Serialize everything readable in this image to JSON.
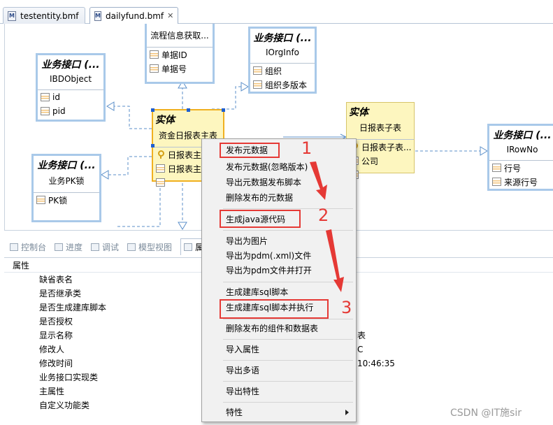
{
  "tabs": [
    {
      "label": "testentity.bmf",
      "icon": "bmf-file-icon"
    },
    {
      "label": "dailyfund.bmf",
      "icon": "bmf-file-icon",
      "close": "✕"
    }
  ],
  "diagram": {
    "nodes": [
      {
        "id": "n1",
        "title": "",
        "sub": "流程信息获取...",
        "attrs": [
          "单据ID",
          "单据号"
        ]
      },
      {
        "id": "n2",
        "title": "业务接口 (...",
        "sub": "IOrgInfo",
        "attrs": [
          "组织",
          "组织多版本"
        ]
      },
      {
        "id": "n3",
        "title": "业务接口 (...",
        "sub": "IBDObject",
        "attrs": [
          "id",
          "pid"
        ]
      },
      {
        "id": "n4",
        "title": "实体",
        "sub": "资金日报表主表",
        "attrs": [
          "日报表主",
          "日报表主",
          ""
        ]
      },
      {
        "id": "n5",
        "title": "实体",
        "sub": "日报表子表",
        "attrs": [
          "日报表子表...",
          "公司",
          ""
        ]
      },
      {
        "id": "n6",
        "title": "业务接口 (...",
        "sub": "IRowNo",
        "attrs": [
          "行号",
          "来源行号"
        ]
      },
      {
        "id": "n7",
        "title": "业务接口 (...",
        "sub": "业务PK锁",
        "attrs": [
          "PK锁"
        ]
      }
    ]
  },
  "panel": {
    "tabs": [
      "控制台",
      "进度",
      "调试",
      "模型视图",
      "属"
    ],
    "header": "属性",
    "rows": [
      {
        "name": "缺省表名",
        "value": ""
      },
      {
        "name": "是否继承类",
        "value": ""
      },
      {
        "name": "是否生成建库脚本",
        "value": ""
      },
      {
        "name": "是否授权",
        "value": ""
      },
      {
        "name": "显示名称",
        "value": "表"
      },
      {
        "name": "修改人",
        "value": "C"
      },
      {
        "name": "修改时间",
        "value": "10:46:35"
      },
      {
        "name": "业务接口实现类",
        "value": ""
      },
      {
        "name": "主属性",
        "value": ""
      },
      {
        "name": "自定义功能类",
        "value": ""
      }
    ]
  },
  "context_menu": {
    "groups": [
      [
        "发布元数据",
        "发布元数据(忽略版本)",
        "导出元数据发布脚本",
        "删除发布的元数据"
      ],
      [
        "生成java源代码"
      ],
      [
        "导出为图片",
        "导出为pdm(.xml)文件",
        "导出为pdm文件并打开"
      ],
      [
        "生成建库sql脚本",
        "生成建库sql脚本并执行"
      ],
      [
        "删除发布的组件和数据表"
      ],
      [
        "导入属性"
      ],
      [
        "导出多语"
      ],
      [
        "导出特性"
      ],
      [
        "特性"
      ]
    ]
  },
  "annotations": {
    "numbers": [
      "1",
      "2",
      "3"
    ],
    "color": "#e53935"
  },
  "watermark": "CSDN @IT施sir"
}
